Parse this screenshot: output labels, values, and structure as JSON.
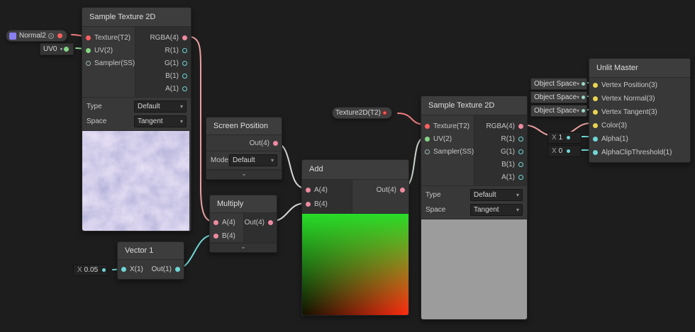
{
  "blackboard": {
    "normal2_label": "Normal2",
    "uv0_label": "UV0",
    "texture2d_label": "Texture2D(T2)"
  },
  "sample1": {
    "title": "Sample Texture 2D",
    "inputs": [
      "Texture(T2)",
      "UV(2)",
      "Sampler(SS)"
    ],
    "outputs": [
      "RGBA(4)",
      "R(1)",
      "G(1)",
      "B(1)",
      "A(1)"
    ],
    "props": [
      {
        "label": "Type",
        "value": "Default"
      },
      {
        "label": "Space",
        "value": "Tangent"
      }
    ]
  },
  "screen_position": {
    "title": "Screen Position",
    "output": "Out(4)",
    "prop_label": "Mode",
    "prop_value": "Default"
  },
  "multiply": {
    "title": "Multiply",
    "inputs": [
      "A(4)",
      "B(4)"
    ],
    "output": "Out(4)"
  },
  "vector1": {
    "title": "Vector 1",
    "input": "X(1)",
    "output": "Out(1)",
    "field_label": "X",
    "field_value": "0.05"
  },
  "add": {
    "title": "Add",
    "inputs": [
      "A(4)",
      "B(4)"
    ],
    "output": "Out(4)"
  },
  "sample2": {
    "title": "Sample Texture 2D",
    "inputs": [
      "Texture(T2)",
      "UV(2)",
      "Sampler(SS)"
    ],
    "outputs": [
      "RGBA(4)",
      "R(1)",
      "G(1)",
      "B(1)",
      "A(1)"
    ],
    "props": [
      {
        "label": "Type",
        "value": "Default"
      },
      {
        "label": "Space",
        "value": "Tangent"
      }
    ]
  },
  "unlit": {
    "title": "Unlit Master",
    "inputs": [
      "Vertex Position(3)",
      "Vertex Normal(3)",
      "Vertex Tangent(3)",
      "Color(3)",
      "Alpha(1)",
      "AlphaClipThreshold(1)"
    ],
    "space_pills": [
      "Object Space",
      "Object Space",
      "Object Space"
    ],
    "alpha_field": {
      "label": "X",
      "value": "1"
    },
    "clip_field": {
      "label": "X",
      "value": "0"
    }
  },
  "colors": {
    "edge_texture": "#f07c7c",
    "edge_vector4": "#eda0a0",
    "edge_vector2": "#96d996",
    "edge_vector1": "#72d8d8",
    "edge_neutral": "#d8d8dc"
  }
}
